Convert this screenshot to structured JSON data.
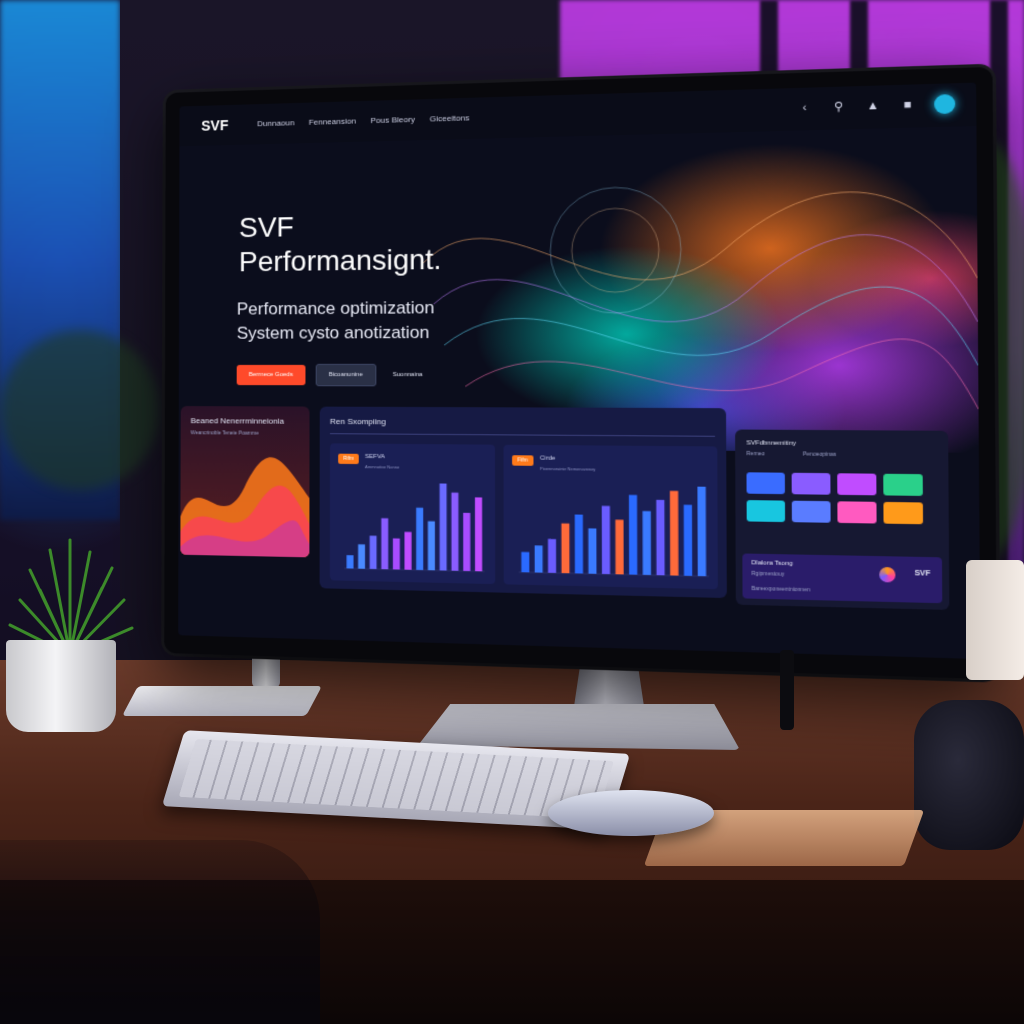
{
  "screen": {
    "logo": "SVF",
    "nav": [
      "Dunnaoun",
      "Fenneansion",
      "Pous Bleory",
      "Giceeitons"
    ],
    "top_icons": [
      "back-icon",
      "search-icon",
      "bell-icon",
      "notification-icon",
      "avatar-icon"
    ],
    "hero": {
      "title_line1": "SVF",
      "title_line2": "Performansignt.",
      "subtitle_line1": "Performance optimization",
      "subtitle_line2": "System cysto anotization",
      "btn_primary": "Berrnece Goeds",
      "btn_secondary": "Bicoanunine",
      "btn_link": "Suonnaina"
    },
    "panels": {
      "left_title": "Beaned Nenerrminneionla",
      "left_sub": "Weancrinoble Teneie Poamme",
      "center_title": "Ren Sxompiing",
      "chart1_badge": "Rifm",
      "chart1_label": "SEFVA",
      "chart1_sub": "Arnmnotive Nonne",
      "chart2_badge": "Fifm",
      "chart2_label": "Cirde",
      "chart2_sub": "Pioennoruinie Nemenoveney",
      "right_title": "SVFdbnnemitiny",
      "right_sub1": "Rerneo",
      "right_sub2": "Penoeopinas",
      "right_card_title": "Dlalora Tsong",
      "right_card_sub": "Rgipmestouy",
      "right_card_brand": "SVF",
      "right_card_foot": "Bareexponeentnionnen"
    },
    "chart_data": [
      {
        "type": "bar",
        "values": [
          12,
          22,
          30,
          46,
          28,
          34,
          56,
          44,
          78,
          70,
          52,
          66
        ],
        "colors": [
          "#3a7bff",
          "#4a8aff",
          "#6a6aff",
          "#8a5cff",
          "#a84cff",
          "#c04cff"
        ]
      },
      {
        "type": "bar",
        "values": [
          18,
          24,
          30,
          44,
          52,
          40,
          60,
          48,
          70,
          56,
          66,
          74,
          62,
          78
        ],
        "colors": [
          "#2a6aff",
          "#3a7aff",
          "#6a5cff",
          "#ff6a3a"
        ]
      }
    ]
  },
  "colors": {
    "accent_orange": "#ff4a2a",
    "tile_colors": [
      "#3a6cff",
      "#8a5cff",
      "#c04cff",
      "#2ad08a",
      "#18c6e0",
      "#5a7cff",
      "#ff5ac0",
      "#ff9a1a"
    ]
  }
}
